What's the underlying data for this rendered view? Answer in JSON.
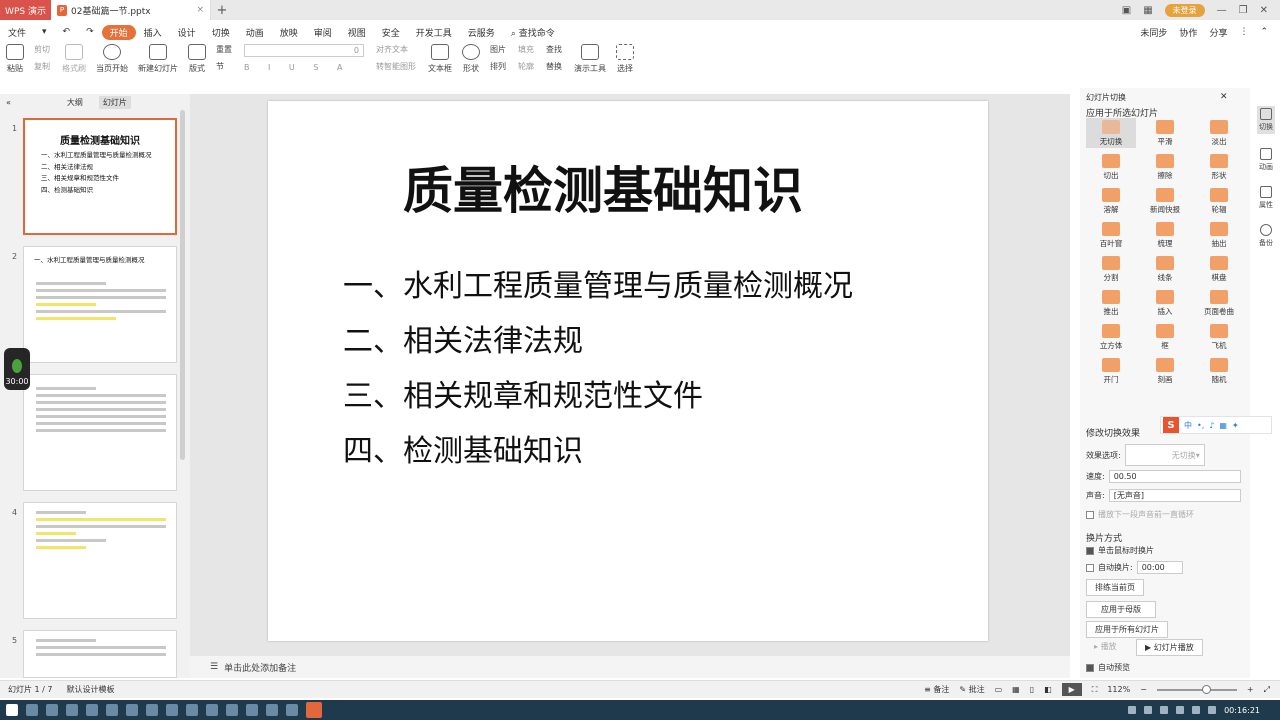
{
  "titlebar": {
    "app": "WPS 演示",
    "doc": "02基础篇一节.pptx",
    "user": "未登录"
  },
  "menu": {
    "items": [
      "文件",
      "开始",
      "插入",
      "设计",
      "切换",
      "动画",
      "放映",
      "审阅",
      "视图",
      "安全",
      "开发工具",
      "云服务"
    ],
    "active_index": 1,
    "search": "查找命令",
    "right": [
      "未同步",
      "协作",
      "分享"
    ]
  },
  "toolbar": {
    "items": [
      {
        "top": "剪切",
        "bottom": "粘贴",
        "dim": false
      },
      {
        "top": "复制",
        "bottom": "格式刷",
        "dim": true
      },
      {
        "top": "",
        "bottom": "当页开始",
        "dim": false
      },
      {
        "top": "",
        "bottom": "新建幻灯片",
        "dim": false
      },
      {
        "top": "重置",
        "bottom": "版式",
        "dim": false
      },
      {
        "top": "",
        "bottom": "节",
        "dim": false
      }
    ],
    "font_size": "0",
    "right_items": [
      "对齐文本",
      "转智能图形",
      "文本框",
      "形状",
      "图片",
      "排列",
      "填充",
      "轮廓",
      "查找",
      "替换",
      "演示工具",
      "选择"
    ]
  },
  "leftpane": {
    "tabs": [
      "大纲",
      "幻灯片"
    ],
    "timer": "30:00"
  },
  "slides": [
    {
      "num": "1",
      "title": "质量检测基础知识",
      "items": [
        "一、水利工程质量管理与质量检测概况",
        "二、相关法律法规",
        "三、相关规章和规范性文件",
        "四、检测基础知识"
      ]
    },
    {
      "num": "2",
      "title": "一、水利工程质量管理与质量检测概况",
      "items": []
    },
    {
      "num": "3",
      "title": "",
      "items": []
    },
    {
      "num": "4",
      "title": "",
      "items": []
    },
    {
      "num": "5",
      "title": "",
      "items": []
    }
  ],
  "main_slide": {
    "title": "质量检测基础知识",
    "items": [
      "一、水利工程质量管理与质量检测概况",
      "二、相关法律法规",
      "三、相关规章和规范性文件",
      "四、检测基础知识"
    ]
  },
  "notes": {
    "placeholder": "单击此处添加备注"
  },
  "panel": {
    "title": "幻灯片切换",
    "apply_header": "应用于所选幻灯片",
    "transitions": [
      "无切换",
      "平滑",
      "淡出",
      "切出",
      "擦除",
      "形状",
      "溶解",
      "新闻快报",
      "轮辐",
      "百叶窗",
      "梳理",
      "抽出",
      "分割",
      "线条",
      "棋盘",
      "推出",
      "插入",
      "页面卷曲",
      "立方体",
      "框",
      "飞机",
      "开门",
      "刻画",
      "随机"
    ],
    "modify": "修改切换效果",
    "effect_label": "效果选项:",
    "effect_value": "无切换",
    "speed_label": "速度:",
    "speed_value": "00.50",
    "sound_label": "声音:",
    "sound_value": "[无声音]",
    "loop_label": "播放下一段声音前一直循环",
    "switch_header": "换片方式",
    "on_click": "单击鼠标时换片",
    "auto_label": "自动换片:",
    "auto_value": "00:00",
    "rehearse": "排练当前页",
    "apply_master": "应用于母版",
    "apply_all": "应用于所有幻灯片",
    "play": "播放",
    "slideshow": "幻灯片播放",
    "autopreview": "自动预览"
  },
  "sidestrip": [
    "切换",
    "动画",
    "属性",
    "备份"
  ],
  "ime": {
    "logo": "S",
    "lang": "中"
  },
  "status": {
    "slide": "幻灯片 1 / 7",
    "theme": "默认设计模板",
    "notes": "备注",
    "comments": "批注",
    "zoom": "112%"
  },
  "tray": {
    "time": "00:16:21"
  }
}
